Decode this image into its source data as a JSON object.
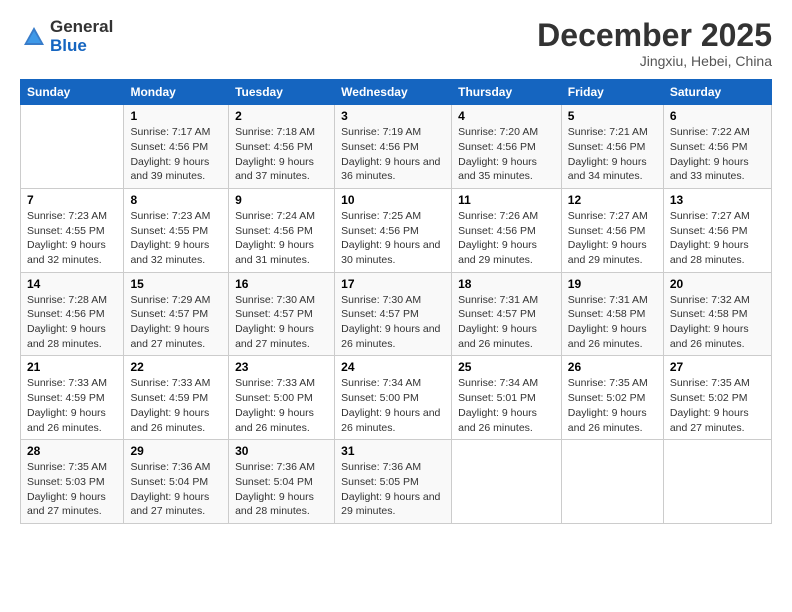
{
  "logo": {
    "general": "General",
    "blue": "Blue"
  },
  "title": {
    "month_year": "December 2025",
    "location": "Jingxiu, Hebei, China"
  },
  "days_of_week": [
    "Sunday",
    "Monday",
    "Tuesday",
    "Wednesday",
    "Thursday",
    "Friday",
    "Saturday"
  ],
  "weeks": [
    [
      {
        "day": "",
        "sunrise": "",
        "sunset": "",
        "daylight": ""
      },
      {
        "day": "1",
        "sunrise": "Sunrise: 7:17 AM",
        "sunset": "Sunset: 4:56 PM",
        "daylight": "Daylight: 9 hours and 39 minutes."
      },
      {
        "day": "2",
        "sunrise": "Sunrise: 7:18 AM",
        "sunset": "Sunset: 4:56 PM",
        "daylight": "Daylight: 9 hours and 37 minutes."
      },
      {
        "day": "3",
        "sunrise": "Sunrise: 7:19 AM",
        "sunset": "Sunset: 4:56 PM",
        "daylight": "Daylight: 9 hours and 36 minutes."
      },
      {
        "day": "4",
        "sunrise": "Sunrise: 7:20 AM",
        "sunset": "Sunset: 4:56 PM",
        "daylight": "Daylight: 9 hours and 35 minutes."
      },
      {
        "day": "5",
        "sunrise": "Sunrise: 7:21 AM",
        "sunset": "Sunset: 4:56 PM",
        "daylight": "Daylight: 9 hours and 34 minutes."
      },
      {
        "day": "6",
        "sunrise": "Sunrise: 7:22 AM",
        "sunset": "Sunset: 4:56 PM",
        "daylight": "Daylight: 9 hours and 33 minutes."
      }
    ],
    [
      {
        "day": "7",
        "sunrise": "Sunrise: 7:23 AM",
        "sunset": "Sunset: 4:55 PM",
        "daylight": "Daylight: 9 hours and 32 minutes."
      },
      {
        "day": "8",
        "sunrise": "Sunrise: 7:23 AM",
        "sunset": "Sunset: 4:55 PM",
        "daylight": "Daylight: 9 hours and 32 minutes."
      },
      {
        "day": "9",
        "sunrise": "Sunrise: 7:24 AM",
        "sunset": "Sunset: 4:56 PM",
        "daylight": "Daylight: 9 hours and 31 minutes."
      },
      {
        "day": "10",
        "sunrise": "Sunrise: 7:25 AM",
        "sunset": "Sunset: 4:56 PM",
        "daylight": "Daylight: 9 hours and 30 minutes."
      },
      {
        "day": "11",
        "sunrise": "Sunrise: 7:26 AM",
        "sunset": "Sunset: 4:56 PM",
        "daylight": "Daylight: 9 hours and 29 minutes."
      },
      {
        "day": "12",
        "sunrise": "Sunrise: 7:27 AM",
        "sunset": "Sunset: 4:56 PM",
        "daylight": "Daylight: 9 hours and 29 minutes."
      },
      {
        "day": "13",
        "sunrise": "Sunrise: 7:27 AM",
        "sunset": "Sunset: 4:56 PM",
        "daylight": "Daylight: 9 hours and 28 minutes."
      }
    ],
    [
      {
        "day": "14",
        "sunrise": "Sunrise: 7:28 AM",
        "sunset": "Sunset: 4:56 PM",
        "daylight": "Daylight: 9 hours and 28 minutes."
      },
      {
        "day": "15",
        "sunrise": "Sunrise: 7:29 AM",
        "sunset": "Sunset: 4:57 PM",
        "daylight": "Daylight: 9 hours and 27 minutes."
      },
      {
        "day": "16",
        "sunrise": "Sunrise: 7:30 AM",
        "sunset": "Sunset: 4:57 PM",
        "daylight": "Daylight: 9 hours and 27 minutes."
      },
      {
        "day": "17",
        "sunrise": "Sunrise: 7:30 AM",
        "sunset": "Sunset: 4:57 PM",
        "daylight": "Daylight: 9 hours and 26 minutes."
      },
      {
        "day": "18",
        "sunrise": "Sunrise: 7:31 AM",
        "sunset": "Sunset: 4:57 PM",
        "daylight": "Daylight: 9 hours and 26 minutes."
      },
      {
        "day": "19",
        "sunrise": "Sunrise: 7:31 AM",
        "sunset": "Sunset: 4:58 PM",
        "daylight": "Daylight: 9 hours and 26 minutes."
      },
      {
        "day": "20",
        "sunrise": "Sunrise: 7:32 AM",
        "sunset": "Sunset: 4:58 PM",
        "daylight": "Daylight: 9 hours and 26 minutes."
      }
    ],
    [
      {
        "day": "21",
        "sunrise": "Sunrise: 7:33 AM",
        "sunset": "Sunset: 4:59 PM",
        "daylight": "Daylight: 9 hours and 26 minutes."
      },
      {
        "day": "22",
        "sunrise": "Sunrise: 7:33 AM",
        "sunset": "Sunset: 4:59 PM",
        "daylight": "Daylight: 9 hours and 26 minutes."
      },
      {
        "day": "23",
        "sunrise": "Sunrise: 7:33 AM",
        "sunset": "Sunset: 5:00 PM",
        "daylight": "Daylight: 9 hours and 26 minutes."
      },
      {
        "day": "24",
        "sunrise": "Sunrise: 7:34 AM",
        "sunset": "Sunset: 5:00 PM",
        "daylight": "Daylight: 9 hours and 26 minutes."
      },
      {
        "day": "25",
        "sunrise": "Sunrise: 7:34 AM",
        "sunset": "Sunset: 5:01 PM",
        "daylight": "Daylight: 9 hours and 26 minutes."
      },
      {
        "day": "26",
        "sunrise": "Sunrise: 7:35 AM",
        "sunset": "Sunset: 5:02 PM",
        "daylight": "Daylight: 9 hours and 26 minutes."
      },
      {
        "day": "27",
        "sunrise": "Sunrise: 7:35 AM",
        "sunset": "Sunset: 5:02 PM",
        "daylight": "Daylight: 9 hours and 27 minutes."
      }
    ],
    [
      {
        "day": "28",
        "sunrise": "Sunrise: 7:35 AM",
        "sunset": "Sunset: 5:03 PM",
        "daylight": "Daylight: 9 hours and 27 minutes."
      },
      {
        "day": "29",
        "sunrise": "Sunrise: 7:36 AM",
        "sunset": "Sunset: 5:04 PM",
        "daylight": "Daylight: 9 hours and 27 minutes."
      },
      {
        "day": "30",
        "sunrise": "Sunrise: 7:36 AM",
        "sunset": "Sunset: 5:04 PM",
        "daylight": "Daylight: 9 hours and 28 minutes."
      },
      {
        "day": "31",
        "sunrise": "Sunrise: 7:36 AM",
        "sunset": "Sunset: 5:05 PM",
        "daylight": "Daylight: 9 hours and 29 minutes."
      },
      {
        "day": "",
        "sunrise": "",
        "sunset": "",
        "daylight": ""
      },
      {
        "day": "",
        "sunrise": "",
        "sunset": "",
        "daylight": ""
      },
      {
        "day": "",
        "sunrise": "",
        "sunset": "",
        "daylight": ""
      }
    ]
  ]
}
